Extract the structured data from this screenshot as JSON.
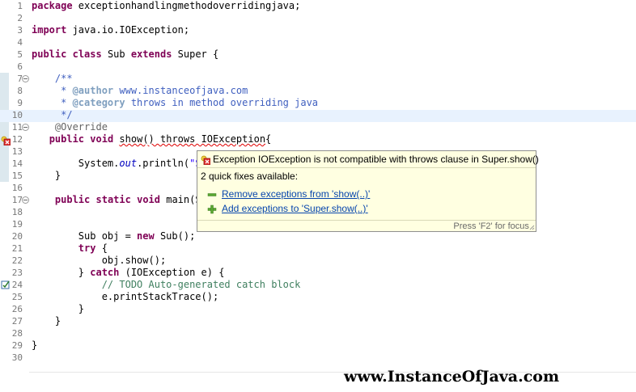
{
  "editor": {
    "lines": [
      {
        "n": "1",
        "code": "package exceptionhandlingmethodoverridingjava;"
      },
      {
        "n": "2",
        "code": ""
      },
      {
        "n": "3",
        "code": "import java.io.IOException;"
      },
      {
        "n": "4",
        "code": ""
      },
      {
        "n": "5",
        "code": "public class Sub extends Super {"
      },
      {
        "n": "6",
        "code": ""
      },
      {
        "n": "7",
        "code": "    /**"
      },
      {
        "n": "8",
        "code": "     * @author www.instanceofjava.com"
      },
      {
        "n": "9",
        "code": "     * @category throws in method overriding java"
      },
      {
        "n": "10",
        "code": "     */"
      },
      {
        "n": "11",
        "code": "    @Override"
      },
      {
        "n": "12",
        "code": "   public void show() throws IOException{"
      },
      {
        "n": "13",
        "code": ""
      },
      {
        "n": "14",
        "code": "        System.out.println(\"S"
      },
      {
        "n": "15",
        "code": "    }"
      },
      {
        "n": "16",
        "code": ""
      },
      {
        "n": "17",
        "code": "    public static void main(S"
      },
      {
        "n": "18",
        "code": ""
      },
      {
        "n": "19",
        "code": ""
      },
      {
        "n": "20",
        "code": "        Sub obj = new Sub();"
      },
      {
        "n": "21",
        "code": "        try {"
      },
      {
        "n": "22",
        "code": "            obj.show();"
      },
      {
        "n": "23",
        "code": "        } catch (IOException e) {"
      },
      {
        "n": "24",
        "code": "            // TODO Auto-generated catch block"
      },
      {
        "n": "25",
        "code": "            e.printStackTrace();"
      },
      {
        "n": "26",
        "code": "        }"
      },
      {
        "n": "27",
        "code": "    }"
      },
      {
        "n": "28",
        "code": ""
      },
      {
        "n": "29",
        "code": "}"
      },
      {
        "n": "30",
        "code": ""
      }
    ]
  },
  "popup": {
    "error_message": "Exception IOException is not compatible with throws clause in Super.show()",
    "quick_fix_count": "2 quick fixes available:",
    "fixes": [
      {
        "label": "Remove exceptions from 'show(..)'",
        "icon": "remove-icon"
      },
      {
        "label": "Add exceptions to 'Super.show(..)'",
        "icon": "add-icon"
      }
    ],
    "footer": "Press 'F2' for focus"
  },
  "watermark": "www.InstanceOfJava.com",
  "colors": {
    "keyword": "#7f0055",
    "javadoc": "#3f5fbf",
    "comment": "#3f7f5f",
    "popup_bg": "#ffffe1",
    "link": "#0645ad"
  }
}
